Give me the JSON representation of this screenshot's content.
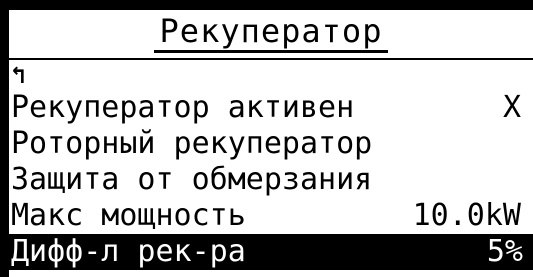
{
  "header": {
    "title": "Рекуператор"
  },
  "menu": {
    "back_icon": "↰",
    "items": [
      {
        "label": "Рекуператор активен",
        "value": "X"
      },
      {
        "label": "Роторный рекуператор",
        "value": ""
      },
      {
        "label": "Защита от обмерзания",
        "value": ""
      },
      {
        "label": "Макс мощность",
        "value": "10.0kW"
      },
      {
        "label": "Дифф-л рек-ра",
        "value": "5%"
      }
    ]
  },
  "colors": {
    "foreground": "#000000",
    "background": "#ffffff",
    "selection": "#000000"
  }
}
